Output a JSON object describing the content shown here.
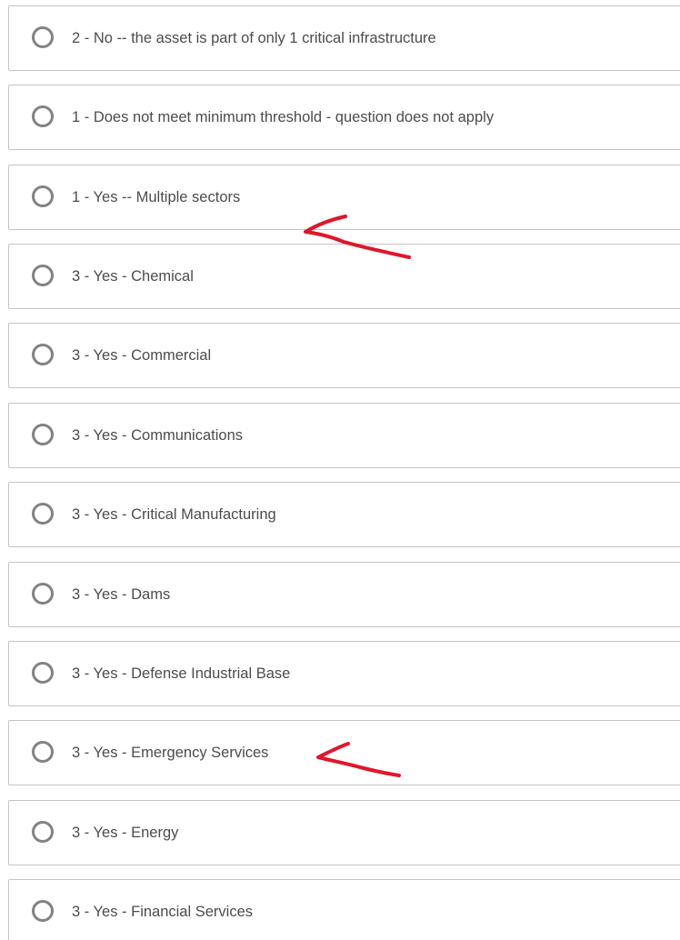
{
  "options": [
    {
      "label": "2 - No -- the asset is part of only 1 critical infrastructure"
    },
    {
      "label": "1 - Does not meet minimum threshold - question does not apply"
    },
    {
      "label": "1 - Yes -- Multiple sectors"
    },
    {
      "label": "3 - Yes - Chemical"
    },
    {
      "label": "3 - Yes - Commercial"
    },
    {
      "label": "3 - Yes - Communications"
    },
    {
      "label": "3 - Yes - Critical Manufacturing"
    },
    {
      "label": "3 - Yes - Dams"
    },
    {
      "label": "3 - Yes - Defense Industrial Base"
    },
    {
      "label": "3 - Yes - Emergency Services"
    },
    {
      "label": "3 - Yes - Energy"
    },
    {
      "label": "3 - Yes - Financial Services"
    }
  ],
  "colors": {
    "border": "#c4c4c4",
    "radio_ring": "#828282",
    "text": "#4c4c4c",
    "annotation": "#e0162b"
  },
  "annotations": [
    {
      "icon": "red-hand-drawn-arrow-icon",
      "points_to": "1 - Yes -- Multiple sectors"
    },
    {
      "icon": "red-hand-drawn-arrow-icon",
      "points_to": "3 - Yes - Emergency Services"
    }
  ]
}
